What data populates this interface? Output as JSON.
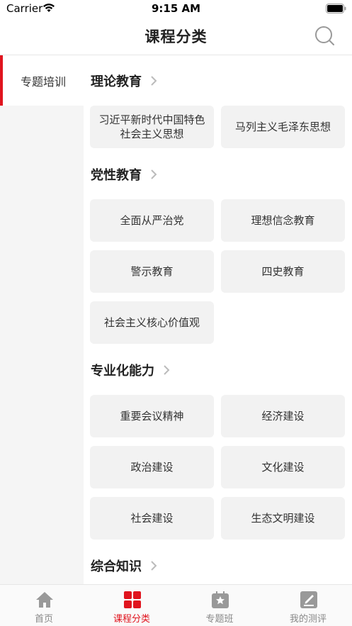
{
  "status_bar": {
    "carrier": "Carrier",
    "time": "9:15 AM"
  },
  "header": {
    "title": "课程分类"
  },
  "sidebar": {
    "items": [
      {
        "label": "专题培训",
        "active": true
      }
    ]
  },
  "sections": [
    {
      "title": "理论教育",
      "items": [
        "习近平新时代中国特色 社会主义思想",
        "马列主义毛泽东思想"
      ]
    },
    {
      "title": "党性教育",
      "items": [
        "全面从严治党",
        "理想信念教育",
        "警示教育",
        "四史教育",
        "社会主义核心价值观"
      ]
    },
    {
      "title": "专业化能力",
      "items": [
        "重要会议精神",
        "经济建设",
        "政治建设",
        "文化建设",
        "社会建设",
        "生态文明建设"
      ]
    },
    {
      "title": "综合知识",
      "items": []
    }
  ],
  "tab_bar": {
    "items": [
      {
        "label": "首页",
        "icon": "home-icon",
        "active": false
      },
      {
        "label": "课程分类",
        "icon": "category-icon",
        "active": true
      },
      {
        "label": "专题班",
        "icon": "class-icon",
        "active": false
      },
      {
        "label": "我的测评",
        "icon": "assessment-icon",
        "active": false
      }
    ]
  },
  "colors": {
    "accent": "#e0141e",
    "card_bg": "#f2f2f2",
    "sidebar_bg": "#f5f5f5"
  }
}
